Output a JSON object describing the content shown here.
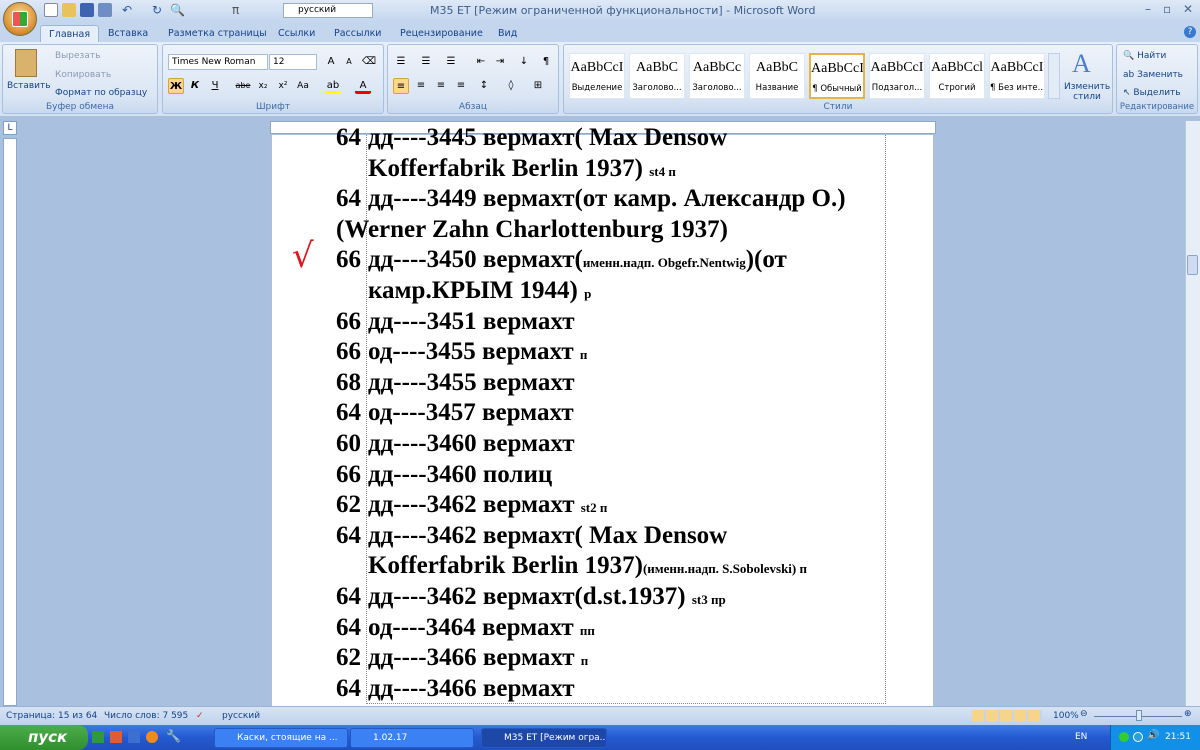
{
  "window": {
    "title": "М35 ЕТ [Режим ограниченной функциональности] - Microsoft Word",
    "language_combo": "русский"
  },
  "tabs": [
    "Главная",
    "Вставка",
    "Разметка страницы",
    "Ссылки",
    "Рассылки",
    "Рецензирование",
    "Вид"
  ],
  "clipboard": {
    "paste": "Вставить",
    "cut": "Вырезать",
    "copy": "Копировать",
    "format_painter": "Формат по образцу",
    "label": "Буфер обмена"
  },
  "font": {
    "name": "Times New Roman",
    "size": "12",
    "bold": "Ж",
    "italic": "К",
    "underline": "Ч",
    "strike": "abe",
    "sub": "x₂",
    "sup": "x²",
    "case": "Aa",
    "label": "Шрифт"
  },
  "paragraph": {
    "label": "Абзац",
    "pilcrow": "¶"
  },
  "styles": {
    "label": "Стили",
    "items": [
      {
        "preview": "AaBbCcI",
        "name": "Выделение"
      },
      {
        "preview": "AaBbC",
        "name": "Заголово..."
      },
      {
        "preview": "AaBbCc",
        "name": "Заголово..."
      },
      {
        "preview": "AaBbC",
        "name": "Название"
      },
      {
        "preview": "AaBbCcI",
        "name": "¶ Обычный"
      },
      {
        "preview": "AaBbCcI",
        "name": "Подзагол..."
      },
      {
        "preview": "AaBbCcl",
        "name": "Строгий"
      },
      {
        "preview": "AaBbCcI",
        "name": "¶ Без инте..."
      }
    ],
    "change": "Изменить стили"
  },
  "editing": {
    "find": "Найти",
    "replace": "Заменить",
    "select": "Выделить",
    "label": "Редактирование"
  },
  "document": {
    "check_mark": "√",
    "lines": [
      {
        "num": "64",
        "segs": [
          {
            "t": "дд----3445 вермахт( Max Densow"
          }
        ]
      },
      {
        "num": "",
        "segs": [
          {
            "t": "Kofferfabrik Berlin 1937) "
          },
          {
            "t": "st4 п",
            "s": 1
          }
        ]
      },
      {
        "num": "64",
        "segs": [
          {
            "t": "дд----3449 вермахт(от камр. Александр О.)"
          }
        ]
      },
      {
        "num": "",
        "flush": 1,
        "segs": [
          {
            "t": "(Werner Zahn Charlottenburg 1937)"
          }
        ]
      },
      {
        "num": "66",
        "segs": [
          {
            "t": "дд----3450 вермахт("
          },
          {
            "t": "именн.надп. Obgefr.Nentwig",
            "s": 1
          },
          {
            "t": ")(от"
          }
        ]
      },
      {
        "num": "",
        "segs": [
          {
            "t": "камр.КРЫМ 1944) "
          },
          {
            "t": "р",
            "s": 1
          }
        ]
      },
      {
        "num": "66",
        "segs": [
          {
            "t": "дд----3451 вермахт"
          }
        ]
      },
      {
        "num": "66",
        "segs": [
          {
            "t": "од----3455 вермахт "
          },
          {
            "t": "п",
            "s": 1
          }
        ]
      },
      {
        "num": "68",
        "segs": [
          {
            "t": "дд----3455 вермахт"
          }
        ]
      },
      {
        "num": "64",
        "segs": [
          {
            "t": "од----3457 вермахт"
          }
        ]
      },
      {
        "num": "60",
        "segs": [
          {
            "t": "дд----3460 вермахт"
          }
        ]
      },
      {
        "num": "66",
        "segs": [
          {
            "t": "дд----3460 полиц"
          }
        ]
      },
      {
        "num": "62",
        "segs": [
          {
            "t": "дд----3462 вермахт "
          },
          {
            "t": "st2 п",
            "s": 1
          }
        ]
      },
      {
        "num": "64",
        "segs": [
          {
            "t": "дд----3462 вермахт( Max Densow"
          }
        ]
      },
      {
        "num": "",
        "segs": [
          {
            "t": "Kofferfabrik Berlin 1937)"
          },
          {
            "t": "(именн.надп. S.Sobolevski)  п",
            "s": 1
          }
        ]
      },
      {
        "num": "64",
        "segs": [
          {
            "t": "дд----3462 вермахт(d.st.1937) "
          },
          {
            "t": "st3  пр",
            "s": 1
          }
        ]
      },
      {
        "num": "64",
        "segs": [
          {
            "t": "од----3464 вермахт "
          },
          {
            "t": "пп",
            "s": 1
          }
        ]
      },
      {
        "num": "62",
        "segs": [
          {
            "t": "дд----3466 вермахт "
          },
          {
            "t": "п",
            "s": 1
          }
        ]
      },
      {
        "num": "64",
        "segs": [
          {
            "t": "дд----3466 вермахт"
          }
        ]
      }
    ]
  },
  "status": {
    "page": "Страница: 15 из 64",
    "words": "Число слов: 7 595",
    "language": "русский",
    "zoom": "100%"
  },
  "taskbar": {
    "start": "пуск",
    "tasks": [
      "Каски, стоящие на ...",
      "1.02.17",
      "М35 ЕТ [Режим огра..."
    ],
    "lang": "EN",
    "clock": "21:51"
  }
}
